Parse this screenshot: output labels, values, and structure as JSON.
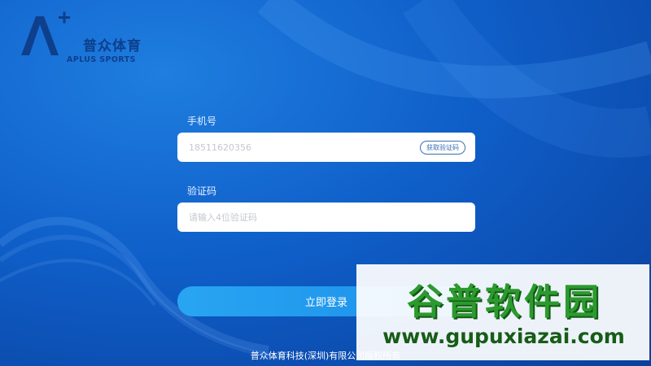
{
  "brand": {
    "name_cn": "普众体育",
    "name_en": "APLUS SPORTS"
  },
  "login_form": {
    "phone_label": "手机号",
    "phone_value": "18511620356",
    "get_code_label": "获取验证码",
    "code_label": "验证码",
    "code_placeholder": "请输入4位验证码",
    "login_label": "立即登录"
  },
  "footer": {
    "copyright": "普众体育科技(深圳)有限公司版权所有"
  },
  "watermark": {
    "title": "谷普软件园",
    "url": "www.gupuxiazai.com"
  },
  "colors": {
    "background": "#1566d2",
    "button": "#1f98ee",
    "brand": "#0e3f8c",
    "watermark_green": "#2c9a2e"
  }
}
